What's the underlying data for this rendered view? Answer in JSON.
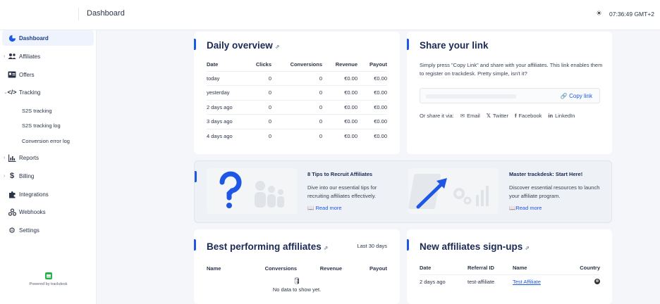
{
  "topbar": {
    "title": "Dashboard",
    "time": "07:36:49 GMT+2",
    "theme_icon": "sun-icon"
  },
  "sidebar": {
    "items": [
      {
        "label": "Dashboard",
        "icon": "dashboard-icon"
      },
      {
        "label": "Affiliates",
        "icon": "users-icon"
      },
      {
        "label": "Offers",
        "icon": "offers-icon"
      },
      {
        "label": "Tracking",
        "icon": "code-icon"
      },
      {
        "label": "Reports",
        "icon": "chart-icon"
      },
      {
        "label": "Billing",
        "icon": "dollar-icon"
      },
      {
        "label": "Integrations",
        "icon": "puzzle-icon"
      },
      {
        "label": "Webhooks",
        "icon": "webhook-icon"
      },
      {
        "label": "Settings",
        "icon": "gear-icon"
      }
    ],
    "tracking_sub": [
      "S2S tracking",
      "S2S tracking log",
      "Conversion error log"
    ],
    "powered_by": "Powered by trackdesk"
  },
  "daily": {
    "title": "Daily overview",
    "columns": [
      "Date",
      "Clicks",
      "Conversions",
      "Revenue",
      "Payout"
    ],
    "rows": [
      [
        "today",
        "0",
        "0",
        "€0.00",
        "€0.00"
      ],
      [
        "yesterday",
        "0",
        "0",
        "€0.00",
        "€0.00"
      ],
      [
        "2 days ago",
        "0",
        "0",
        "€0.00",
        "€0.00"
      ],
      [
        "3 days ago",
        "0",
        "0",
        "€0.00",
        "€0.00"
      ],
      [
        "4 days ago",
        "0",
        "0",
        "€0.00",
        "€0.00"
      ]
    ]
  },
  "share": {
    "title": "Share your link",
    "desc": "Simply press \"Copy Link\" and share with your affiliates. This link enables them to register on trackdesk. Pretty simple, isn't it?",
    "copy_label": "Copy link",
    "via_label": "Or share it via:",
    "channels": [
      "Email",
      "Twitter",
      "Facebook",
      "LinkedIn"
    ]
  },
  "tips": [
    {
      "title": "8 Tips to Recruit Affiliates",
      "desc": "Dive into our essential tips for recruiting affiliates effectively.",
      "link": "Read more"
    },
    {
      "title": "Master trackdesk: Start Here!",
      "desc": "Discover essential resources to launch your affiliate program.",
      "link": "Read more"
    }
  ],
  "best": {
    "title": "Best performing affiliates",
    "period": "Last 30 days",
    "columns": [
      "Name",
      "Conversions",
      "Revenue",
      "Payout"
    ],
    "empty": "No data to show yet."
  },
  "signups": {
    "title": "New affiliates sign-ups",
    "columns": [
      "Date",
      "Referral ID",
      "Name",
      "Country"
    ],
    "rows": [
      [
        "2 days ago",
        "test-affiliate",
        "Test Affiliate",
        ""
      ]
    ]
  },
  "colors": {
    "accent": "#1e57e6",
    "brand_green": "#27b24a",
    "heading": "#1b2a55"
  }
}
